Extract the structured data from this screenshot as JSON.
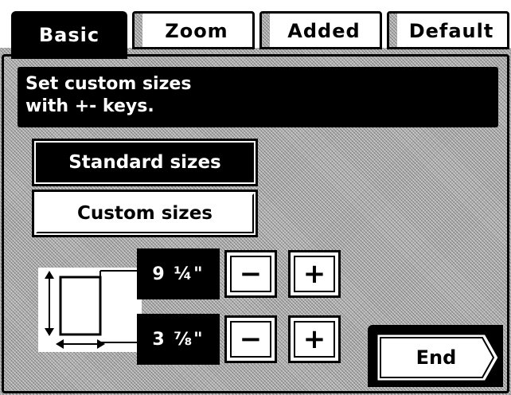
{
  "tabs": [
    {
      "label": "Basic",
      "active": true
    },
    {
      "label": "Zoom",
      "active": false
    },
    {
      "label": "Added",
      "active": false
    },
    {
      "label": "Default",
      "active": false
    }
  ],
  "message": {
    "line1": "Set custom sizes",
    "line2": "with +- keys."
  },
  "size_mode": {
    "standard_label": "Standard sizes",
    "custom_label": "Custom sizes",
    "selected": "Standard sizes"
  },
  "dimensions": {
    "width_value": "9 ¼\"",
    "height_value": "3 ⅞\"",
    "minus_label": "−",
    "plus_label": "+"
  },
  "footer": {
    "end_label": "End"
  },
  "icons": [
    "paper-size-icon",
    "end-arrow-icon"
  ]
}
